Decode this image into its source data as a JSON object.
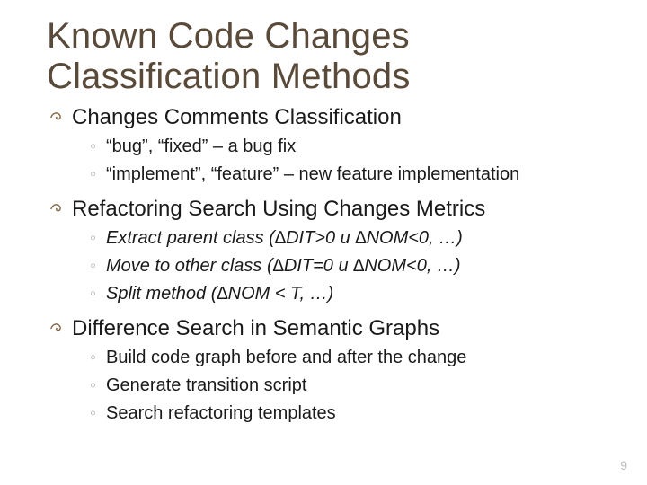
{
  "title_line1": "Known Code Changes",
  "title_line2": "Classification Methods",
  "sections": [
    {
      "heading": "Changes Comments Classification",
      "items": [
        {
          "text": "“bug”, “fixed” – a bug fix",
          "italic": false
        },
        {
          "text": "“implement”, “feature” – new feature implementation",
          "italic": false
        }
      ]
    },
    {
      "heading": "Refactoring Search Using Changes Metrics",
      "items": [
        {
          "text": "Extract parent class (∆DIT>0 и ∆NOM<0, …)",
          "italic": true
        },
        {
          "text": "Move to other class (∆DIT=0 и ∆NOM<0, …)",
          "italic": true
        },
        {
          "text": "Split method (∆NOM < T, …)",
          "italic": true
        }
      ]
    },
    {
      "heading": "Difference Search in Semantic Graphs",
      "items": [
        {
          "text": "Build code graph before and after the change",
          "italic": false
        },
        {
          "text": "Generate transition script",
          "italic": false
        },
        {
          "text": "Search refactoring templates",
          "italic": false
        }
      ]
    }
  ],
  "page_number": "9"
}
